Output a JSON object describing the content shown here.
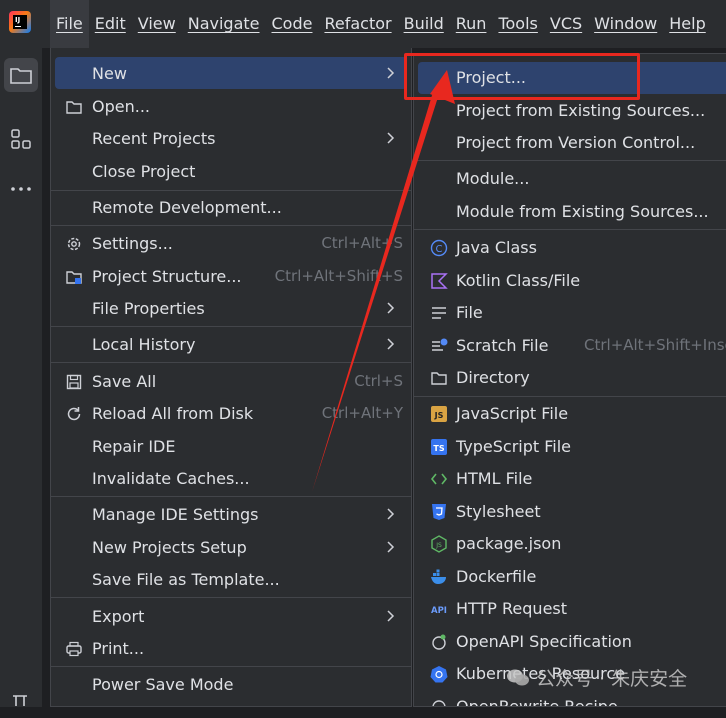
{
  "menubar": {
    "items": [
      "File",
      "Edit",
      "View",
      "Navigate",
      "Code",
      "Refactor",
      "Build",
      "Run",
      "Tools",
      "VCS",
      "Window",
      "Help"
    ]
  },
  "file_menu": {
    "new": "New",
    "open": "Open...",
    "recent_projects": "Recent Projects",
    "close_project": "Close Project",
    "remote_development": "Remote Development...",
    "settings": "Settings...",
    "settings_shortcut": "Ctrl+Alt+S",
    "project_structure": "Project Structure...",
    "project_structure_shortcut": "Ctrl+Alt+Shift+S",
    "file_properties": "File Properties",
    "local_history": "Local History",
    "save_all": "Save All",
    "save_all_shortcut": "Ctrl+S",
    "reload_all": "Reload All from Disk",
    "reload_all_shortcut": "Ctrl+Alt+Y",
    "repair_ide": "Repair IDE",
    "invalidate_caches": "Invalidate Caches...",
    "manage_ide_settings": "Manage IDE Settings",
    "new_projects_setup": "New Projects Setup",
    "save_file_as_template": "Save File as Template...",
    "export": "Export",
    "print": "Print...",
    "power_save_mode": "Power Save Mode"
  },
  "new_submenu": {
    "project": "Project...",
    "project_existing_sources": "Project from Existing Sources...",
    "project_vcs": "Project from Version Control...",
    "module": "Module...",
    "module_existing_sources": "Module from Existing Sources...",
    "java_class": "Java Class",
    "kotlin_class": "Kotlin Class/File",
    "file": "File",
    "scratch_file": "Scratch File",
    "scratch_file_shortcut": "Ctrl+Alt+Shift+Insert",
    "directory": "Directory",
    "javascript_file": "JavaScript File",
    "typescript_file": "TypeScript File",
    "html_file": "HTML File",
    "stylesheet": "Stylesheet",
    "package_json": "package.json",
    "dockerfile": "Dockerfile",
    "http_request": "HTTP Request",
    "openapi_spec": "OpenAPI Specification",
    "kubernetes_resource": "Kubernetes Resource",
    "openrewrite_recipe": "OpenRewrite Recipe"
  },
  "icon_text": {
    "js": "JS",
    "ts": "TS",
    "api": "API",
    "java_c": "C",
    "json_js": "JS",
    "ij": "IJ"
  },
  "watermark": "公众号 · 朱庆安全",
  "colors": {
    "accent_highlight": "#2e436e",
    "annotation_red": "#e8281f",
    "background": "#2b2d30"
  }
}
